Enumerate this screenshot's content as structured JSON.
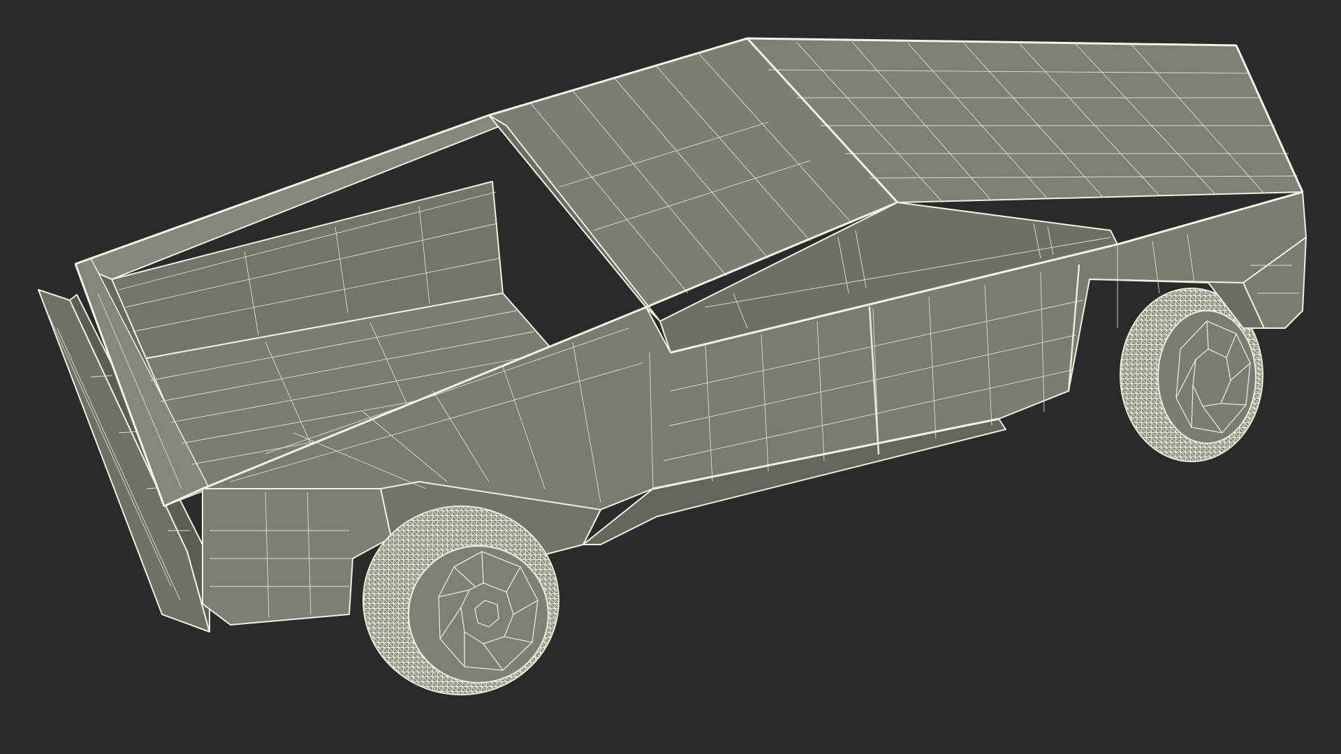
{
  "scene": {
    "subject": "cybertruck-wireframe-render",
    "colors": {
      "background": "#2a2a2a",
      "surface_light": "#82847a",
      "surface_mid": "#74766d",
      "surface_dark": "#5f6159",
      "bed_interior": "#6b6d64",
      "wire": "#e8ead8",
      "tire": "#b4b6a6"
    }
  }
}
